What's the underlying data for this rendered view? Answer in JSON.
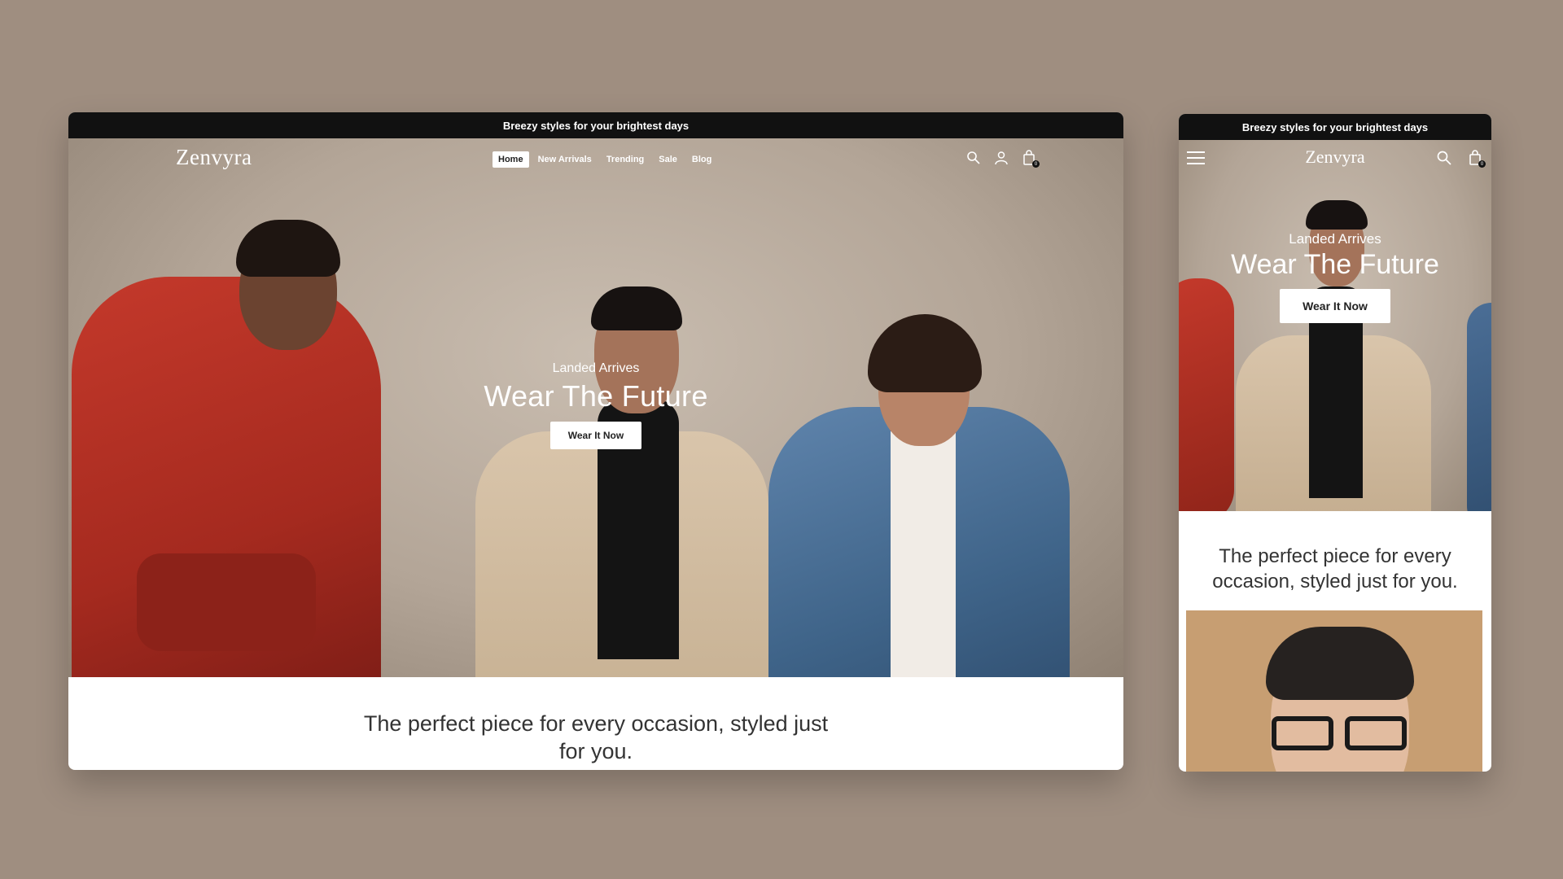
{
  "desktop": {
    "announcement": "Breezy styles for your brightest days",
    "logo": "Zenvyra",
    "menu": [
      {
        "label": "Home",
        "active": true
      },
      {
        "label": "New Arrivals",
        "active": false
      },
      {
        "label": "Trending",
        "active": false
      },
      {
        "label": "Sale",
        "active": false
      },
      {
        "label": "Blog",
        "active": false
      }
    ],
    "icons": [
      "search-icon",
      "account-icon",
      "cart-icon"
    ],
    "cart_count": "0",
    "hero": {
      "eyebrow": "Landed Arrives",
      "title": "Wear The Future",
      "button": "Wear It Now"
    },
    "tagline": "The perfect piece for every occasion, styled just for you."
  },
  "mobile": {
    "announcement": "Breezy styles for your brightest days",
    "logo": "Zenvyra",
    "icons": [
      "menu-icon",
      "search-icon",
      "cart-icon"
    ],
    "cart_count": "0",
    "hero": {
      "eyebrow": "Landed Arrives",
      "title": "Wear The Future",
      "button": "Wear It Now"
    },
    "tagline": "The perfect piece for every occasion, styled just for you."
  },
  "colors": {
    "page_bg": "#9f8e80",
    "announcement_bg": "#111111",
    "button_bg": "#ffffff"
  }
}
